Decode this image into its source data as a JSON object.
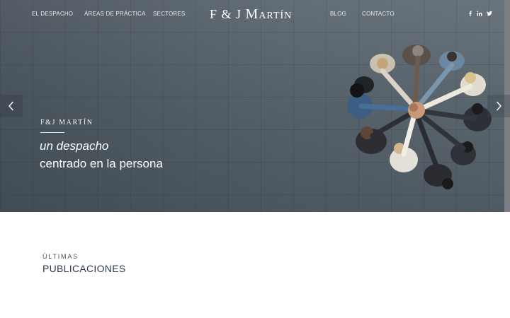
{
  "nav": {
    "left_links": [
      "EL DESPACHO",
      "ÁREAS DE PRÁCTICA",
      "SECTORES"
    ],
    "right_links": [
      "BLOG",
      "CONTACTO"
    ],
    "logo": {
      "part1": "F & J",
      "part2": "Martín"
    },
    "social_icons": [
      "facebook-icon",
      "linkedin-icon",
      "twitter-icon"
    ]
  },
  "hero": {
    "eyebrow": "F&J MARTÍN",
    "tagline_line1": "un despacho",
    "tagline_line2": "centrado en la persona",
    "arrows": {
      "prev_icon": "chevron-left-icon",
      "next_icon": "chevron-right-icon"
    }
  },
  "publications": {
    "kicker": "ÚLTIMAS",
    "title": "PUBLICACIONES"
  }
}
